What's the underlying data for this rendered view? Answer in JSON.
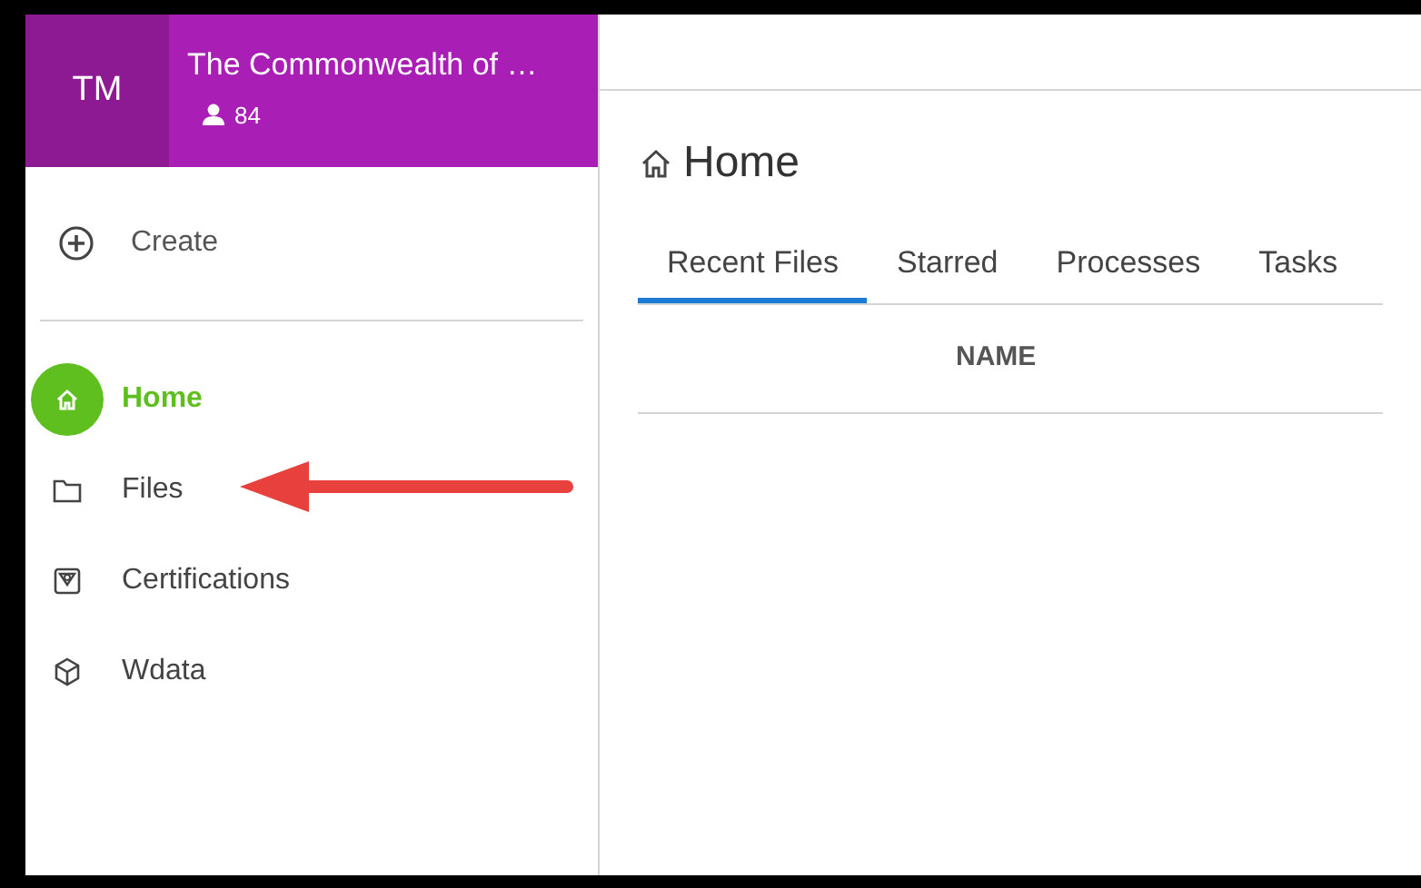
{
  "workspace": {
    "initials": "TM",
    "name": "The Commonwealth of …",
    "members": "84"
  },
  "create": {
    "label": "Create"
  },
  "nav": [
    {
      "label": "Home",
      "selected": true
    },
    {
      "label": "Files",
      "selected": false
    },
    {
      "label": "Certifications",
      "selected": false
    },
    {
      "label": "Wdata",
      "selected": false
    }
  ],
  "page": {
    "title": "Home"
  },
  "tabs": [
    {
      "label": "Recent Files",
      "selected": true
    },
    {
      "label": "Starred",
      "selected": false
    },
    {
      "label": "Processes",
      "selected": false
    },
    {
      "label": "Tasks",
      "selected": false
    }
  ],
  "table": {
    "columns": [
      "NAME"
    ]
  }
}
